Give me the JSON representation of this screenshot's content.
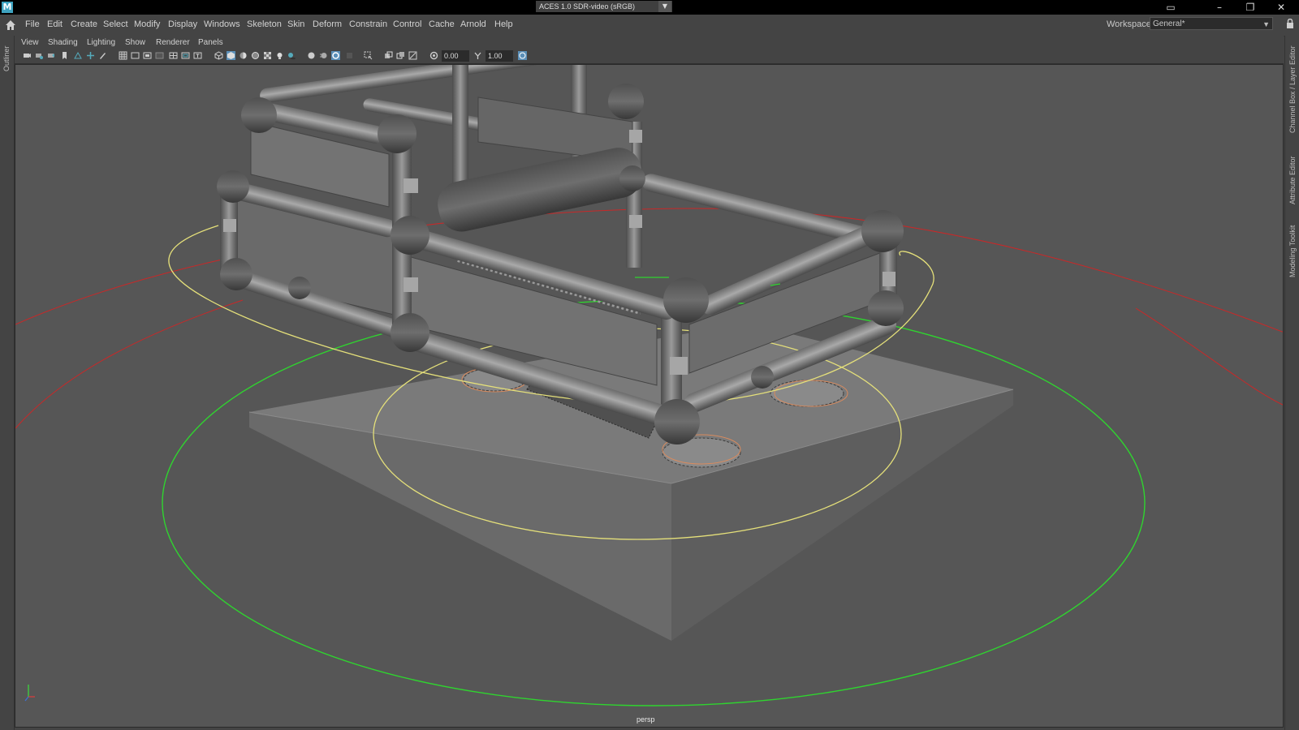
{
  "app": {
    "logo_letter": "M"
  },
  "menu": {
    "items": [
      "File",
      "Edit",
      "Create",
      "Select",
      "Modify",
      "Display",
      "Windows",
      "Skeleton",
      "Skin",
      "Deform",
      "Constrain",
      "Control",
      "Cache",
      "Arnold",
      "Help"
    ]
  },
  "workspace": {
    "label": "Workspace:",
    "value": "General*"
  },
  "side_tabs": {
    "left": "Outliner",
    "right_top": "Channel Box / Layer Editor",
    "right_mid": "Attribute Editor",
    "right_bot": "Modeling Toolkit"
  },
  "panel_menu": {
    "items": [
      "View",
      "Shading",
      "Lighting",
      "Show",
      "Renderer",
      "Panels"
    ]
  },
  "toolbar": {
    "exposure": "0.00",
    "gamma": "1.00",
    "color_space": "ACES 1.0 SDR-video (sRGB)"
  },
  "viewport": {
    "camera": "persp"
  },
  "colors": {
    "viewport_bg": "#565656",
    "selection_yellow": "#e5e07a",
    "ctrl_green": "#33cc33",
    "ctrl_red": "#cc2a2a"
  },
  "icons": [
    "home-icon",
    "lock-icon",
    "minimize-icon",
    "restore-icon",
    "close-icon"
  ]
}
